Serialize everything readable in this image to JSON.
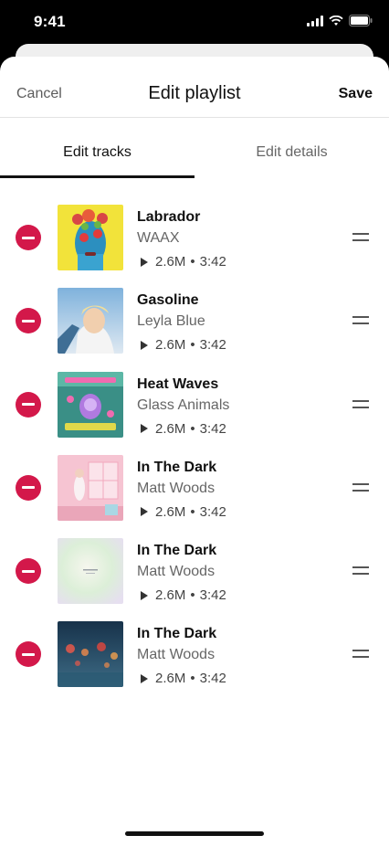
{
  "status_bar": {
    "time": "9:41"
  },
  "header": {
    "cancel": "Cancel",
    "title": "Edit playlist",
    "save": "Save"
  },
  "tabs": [
    {
      "label": "Edit tracks",
      "active": true
    },
    {
      "label": "Edit details",
      "active": false
    }
  ],
  "tracks": [
    {
      "title": "Labrador",
      "artist": "WAAX",
      "plays": "2.6M",
      "separator": "•",
      "duration": "3:42",
      "cover": "labrador-cover"
    },
    {
      "title": "Gasoline",
      "artist": "Leyla Blue",
      "plays": "2.6M",
      "separator": "•",
      "duration": "3:42",
      "cover": "gasoline-cover"
    },
    {
      "title": "Heat Waves",
      "artist": "Glass Animals",
      "plays": "2.6M",
      "separator": "•",
      "duration": "3:42",
      "cover": "heat-waves-cover"
    },
    {
      "title": "In The Dark",
      "artist": "Matt Woods",
      "plays": "2.6M",
      "separator": "•",
      "duration": "3:42",
      "cover": "pink-room-cover"
    },
    {
      "title": "In The Dark",
      "artist": "Matt Woods",
      "plays": "2.6M",
      "separator": "•",
      "duration": "3:42",
      "cover": "pastel-cover"
    },
    {
      "title": "In The Dark",
      "artist": "Matt Woods",
      "plays": "2.6M",
      "separator": "•",
      "duration": "3:42",
      "cover": "rainy-window-cover"
    }
  ],
  "colors": {
    "remove": "#d3184a",
    "text": "#111111",
    "muted": "#666666"
  }
}
